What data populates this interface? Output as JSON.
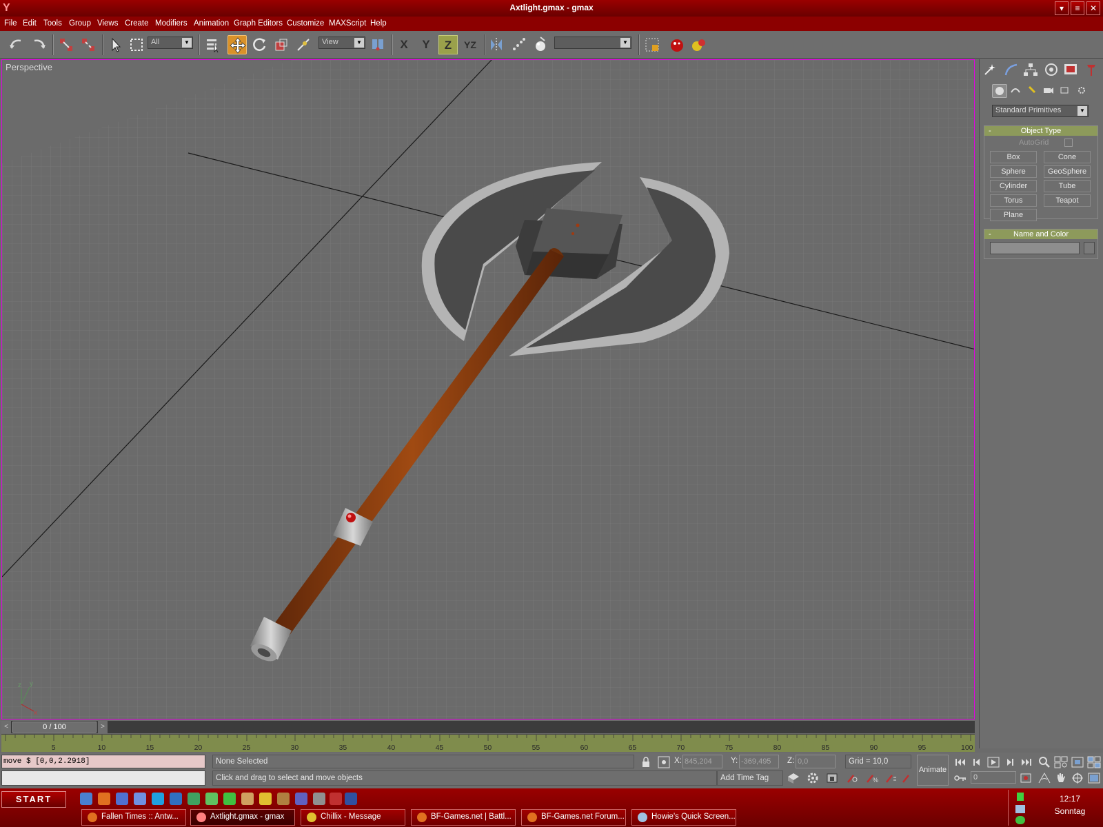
{
  "window": {
    "title": "Axtlight.gmax - gmax"
  },
  "menu": [
    "File",
    "Edit",
    "Tools",
    "Group",
    "Views",
    "Create",
    "Modifiers",
    "Animation",
    "Graph Editors",
    "Customize",
    "MAXScript",
    "Help"
  ],
  "toolbar": {
    "selection_filter": "All",
    "reference_coord": "View",
    "axis_x": "X",
    "axis_y": "Y",
    "axis_z": "Z",
    "axis_yz": "YZ",
    "named_selection": ""
  },
  "viewport": {
    "label": "Perspective",
    "axis_gizmo": {
      "z": "z",
      "y": "y",
      "x": "x"
    }
  },
  "command_panel": {
    "category": "Standard Primitives",
    "object_type": {
      "title": "Object Type",
      "autogrid": "AutoGrid",
      "buttons": [
        "Box",
        "Cone",
        "Sphere",
        "GeoSphere",
        "Cylinder",
        "Tube",
        "Torus",
        "Teapot",
        "Plane"
      ]
    },
    "name_and_color": {
      "title": "Name and Color",
      "name": ""
    }
  },
  "timeline": {
    "slider_label": "0 / 100",
    "ticks": [
      "5",
      "10",
      "15",
      "20",
      "25",
      "30",
      "35",
      "40",
      "45",
      "50",
      "55",
      "60",
      "65",
      "70",
      "75",
      "80",
      "85",
      "90",
      "95",
      "100"
    ]
  },
  "status": {
    "listener_output": "move $ [0,0,2.2918]",
    "selection": "None Selected",
    "prompt": "Click and drag to select and move objects",
    "x_label": "X:",
    "x_value": "845,204",
    "y_label": "Y:",
    "y_value": "-369,495",
    "z_label": "Z:",
    "z_value": "0,0",
    "grid": "Grid = 10,0",
    "add_time_tag": "Add Time Tag",
    "animate": "Animate",
    "current_frame": "0"
  },
  "taskbar": {
    "start": "START",
    "tasks": [
      "Fallen Times :: Antw...",
      "Axtlight.gmax - gmax",
      "Chillix - Message",
      "BF-Games.net | Battl...",
      "BF-Games.net Forum...",
      "Howie's Quick Screen..."
    ],
    "clock": "12:17",
    "day": "Sonntag"
  },
  "colors": {
    "title_red": "#8c0000",
    "viewport_bg": "#6b6b6b",
    "handle_wood": "#8b3f0c",
    "blade_dark": "#4a4a4a",
    "blade_edge": "#a8a8a8",
    "rollout_head": "#8d9a5b",
    "selection_highlight": "#e000e0"
  }
}
